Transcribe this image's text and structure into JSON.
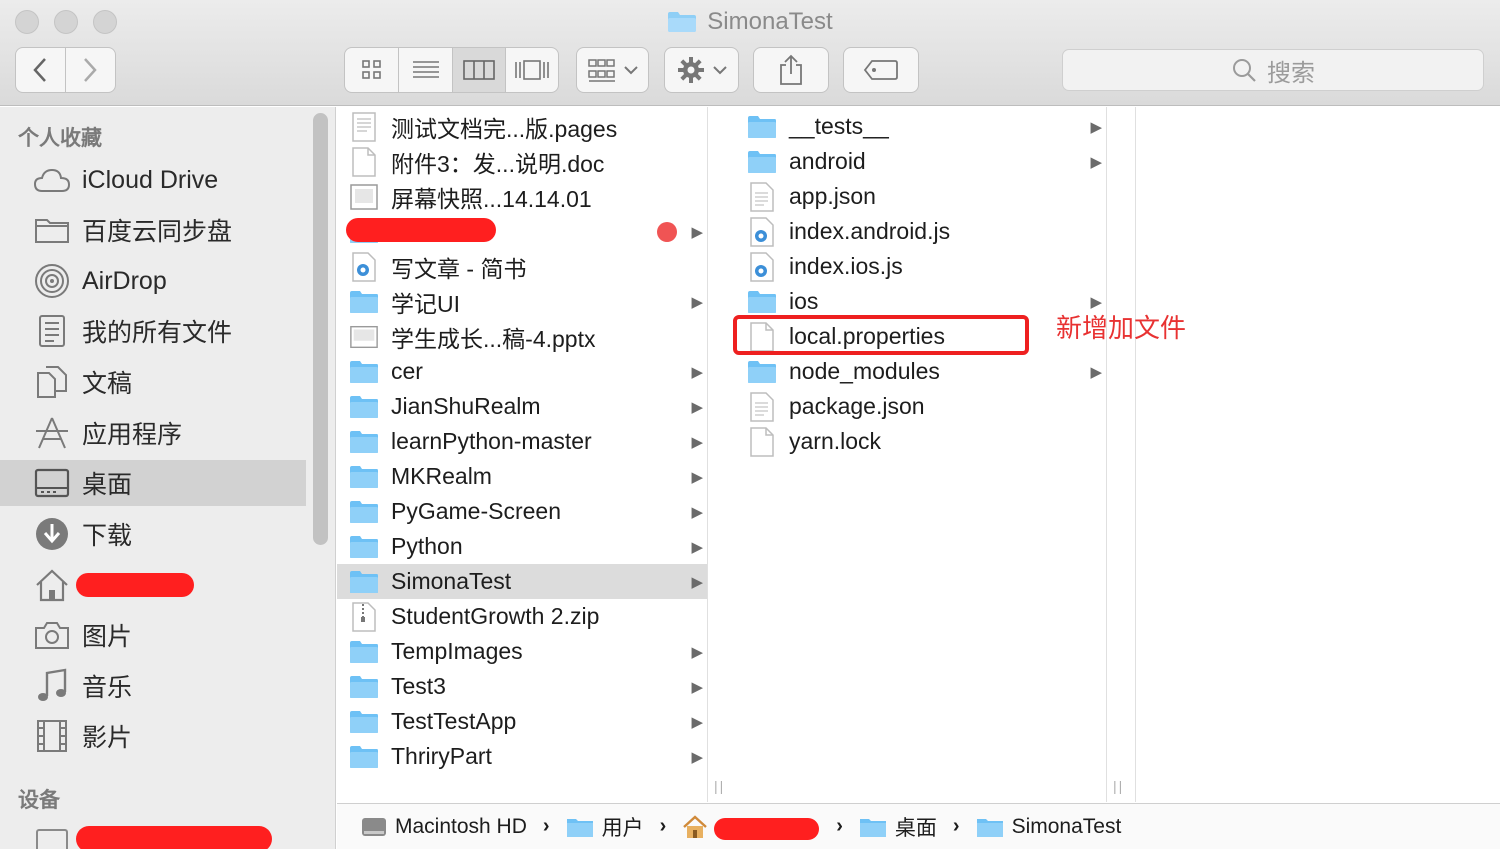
{
  "window": {
    "title": "SimonaTest"
  },
  "toolbar": {
    "search_placeholder": "搜索"
  },
  "sidebar": {
    "favorites_heading": "个人收藏",
    "devices_heading": "设备",
    "items": [
      {
        "label": "iCloud Drive",
        "icon": "cloud-icon"
      },
      {
        "label": "百度云同步盘",
        "icon": "folder-icon"
      },
      {
        "label": "AirDrop",
        "icon": "airdrop-icon"
      },
      {
        "label": "我的所有文件",
        "icon": "all-files-icon"
      },
      {
        "label": "文稿",
        "icon": "documents-icon"
      },
      {
        "label": "应用程序",
        "icon": "applications-icon"
      },
      {
        "label": "桌面",
        "icon": "desktop-icon",
        "selected": true
      },
      {
        "label": "下载",
        "icon": "download-icon"
      },
      {
        "label": "",
        "icon": "home-icon",
        "redacted": true
      },
      {
        "label": "图片",
        "icon": "camera-icon"
      },
      {
        "label": "音乐",
        "icon": "music-icon"
      },
      {
        "label": "影片",
        "icon": "film-icon"
      }
    ]
  },
  "column1": {
    "items": [
      {
        "name": "测试文档完...版.pages",
        "kind": "pages"
      },
      {
        "name": "附件3：发...说明.doc",
        "kind": "doc"
      },
      {
        "name": "屏幕快照...14.14.01",
        "kind": "image"
      },
      {
        "name": "",
        "kind": "folder",
        "redacted": true,
        "tag": "red"
      },
      {
        "name": "写文章 - 简书",
        "kind": "webloc"
      },
      {
        "name": "学记UI",
        "kind": "folder"
      },
      {
        "name": "学生成长...稿-4.pptx",
        "kind": "pptx"
      },
      {
        "name": "cer",
        "kind": "folder"
      },
      {
        "name": "JianShuRealm",
        "kind": "folder"
      },
      {
        "name": "learnPython-master",
        "kind": "folder"
      },
      {
        "name": "MKRealm",
        "kind": "folder"
      },
      {
        "name": "PyGame-Screen",
        "kind": "folder"
      },
      {
        "name": "Python",
        "kind": "folder"
      },
      {
        "name": "SimonaTest",
        "kind": "folder",
        "selected": true
      },
      {
        "name": "StudentGrowth 2.zip",
        "kind": "zip"
      },
      {
        "name": "TempImages",
        "kind": "folder"
      },
      {
        "name": "Test3",
        "kind": "folder"
      },
      {
        "name": "TestTestApp",
        "kind": "folder"
      },
      {
        "name": "ThriryPart",
        "kind": "folder"
      }
    ]
  },
  "column2": {
    "items": [
      {
        "name": "__tests__",
        "kind": "folder"
      },
      {
        "name": "android",
        "kind": "folder"
      },
      {
        "name": "app.json",
        "kind": "file"
      },
      {
        "name": "index.android.js",
        "kind": "js"
      },
      {
        "name": "index.ios.js",
        "kind": "js"
      },
      {
        "name": "ios",
        "kind": "folder"
      },
      {
        "name": "local.properties",
        "kind": "blank",
        "highlighted": true
      },
      {
        "name": "node_modules",
        "kind": "folder"
      },
      {
        "name": "package.json",
        "kind": "file"
      },
      {
        "name": "yarn.lock",
        "kind": "blank"
      }
    ]
  },
  "annotation": {
    "text": "新增加文件",
    "color": "#e83232"
  },
  "pathbar": {
    "items": [
      {
        "label": "Macintosh HD",
        "icon": "disk-icon"
      },
      {
        "label": "用户",
        "icon": "folder-icon"
      },
      {
        "label": "",
        "icon": "home-icon",
        "redacted": true
      },
      {
        "label": "桌面",
        "icon": "folder-icon"
      },
      {
        "label": "SimonaTest",
        "icon": "folder-icon"
      }
    ]
  },
  "colors": {
    "folder": "#6ec1f5",
    "selection": "#dcdcdc",
    "redaction": "#ff1f1f"
  }
}
